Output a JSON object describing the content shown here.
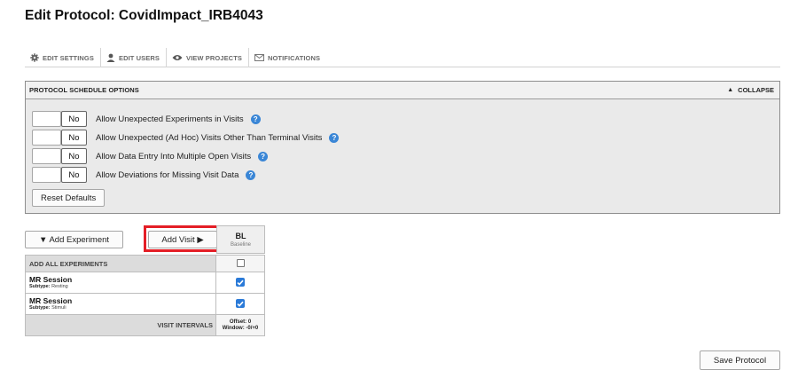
{
  "page": {
    "title": "Edit Protocol: CovidImpact_IRB4043"
  },
  "tabs": [
    {
      "label": "EDIT SETTINGS",
      "icon": "gear-icon"
    },
    {
      "label": "EDIT USERS",
      "icon": "user-icon"
    },
    {
      "label": "VIEW PROJECTS",
      "icon": "eye-icon"
    },
    {
      "label": "NOTIFICATIONS",
      "icon": "mail-icon"
    }
  ],
  "schedule": {
    "title": "PROTOCOL SCHEDULE OPTIONS",
    "collapse_label": "COLLAPSE",
    "collapse_icon": "triangle-up-icon",
    "options": [
      {
        "value": "No",
        "label": "Allow Unexpected Experiments in Visits"
      },
      {
        "value": "No",
        "label": "Allow Unexpected (Ad Hoc) Visits Other Than Terminal Visits"
      },
      {
        "value": "No",
        "label": "Allow Data Entry Into Multiple Open Visits"
      },
      {
        "value": "No",
        "label": "Allow Deviations for Missing Visit Data"
      }
    ],
    "help_glyph": "?",
    "reset_label": "Reset Defaults"
  },
  "grid": {
    "add_experiment_label": "▼ Add Experiment",
    "add_visit_label": "Add Visit ▶",
    "visit": {
      "code": "BL",
      "name": "Baseline"
    },
    "add_all_label": "ADD ALL EXPERIMENTS",
    "add_all_checked": false,
    "experiments": [
      {
        "name": "MR Session",
        "subtype_label": "Subtype:",
        "subtype": "Resting",
        "checked": true
      },
      {
        "name": "MR Session",
        "subtype_label": "Subtype:",
        "subtype": "Stimuli",
        "checked": true
      }
    ],
    "intervals_label": "VISIT INTERVALS",
    "offset_text": "Offset: 0",
    "window_text": "Window: -0/+0"
  },
  "save_label": "Save Protocol",
  "colors": {
    "accent": "#2a7ad8",
    "highlight": "#e41e26",
    "help": "#3a86d6"
  }
}
